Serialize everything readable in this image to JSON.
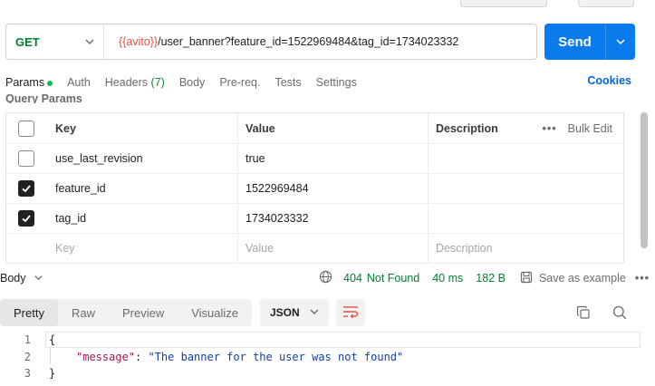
{
  "request": {
    "method": "GET",
    "url_variable": "{{avito}}",
    "url_path": "/user_banner?feature_id=1522969484&tag_id=1734023332",
    "send_label": "Send"
  },
  "tabs": {
    "params": "Params",
    "auth": "Auth",
    "headers": "Headers",
    "headers_count": "(7)",
    "body": "Body",
    "prereq": "Pre-req.",
    "tests": "Tests",
    "settings": "Settings",
    "cookies": "Cookies"
  },
  "query_params": {
    "title": "Query Params",
    "columns": {
      "key": "Key",
      "value": "Value",
      "description": "Description",
      "bulk_edit": "Bulk Edit"
    },
    "rows": [
      {
        "checked": false,
        "key": "use_last_revision",
        "value": "true",
        "description": ""
      },
      {
        "checked": true,
        "key": "feature_id",
        "value": "1522969484",
        "description": ""
      },
      {
        "checked": true,
        "key": "tag_id",
        "value": "1734023332",
        "description": ""
      }
    ],
    "placeholder": {
      "key": "Key",
      "value": "Value",
      "description": "Description"
    }
  },
  "response": {
    "section_label": "Body",
    "status_code": "404",
    "status_text": "Not Found",
    "time": "40 ms",
    "size": "182 B",
    "save_example": "Save as example",
    "view_tabs": [
      "Pretty",
      "Raw",
      "Preview",
      "Visualize"
    ],
    "active_view": "Pretty",
    "format": "JSON",
    "code_lines": [
      {
        "num": "1",
        "open": "{"
      },
      {
        "num": "2",
        "key": "\"message\"",
        "sep": ": ",
        "value": "\"The banner for the user was not found\""
      },
      {
        "num": "3",
        "close": "}"
      }
    ]
  }
}
